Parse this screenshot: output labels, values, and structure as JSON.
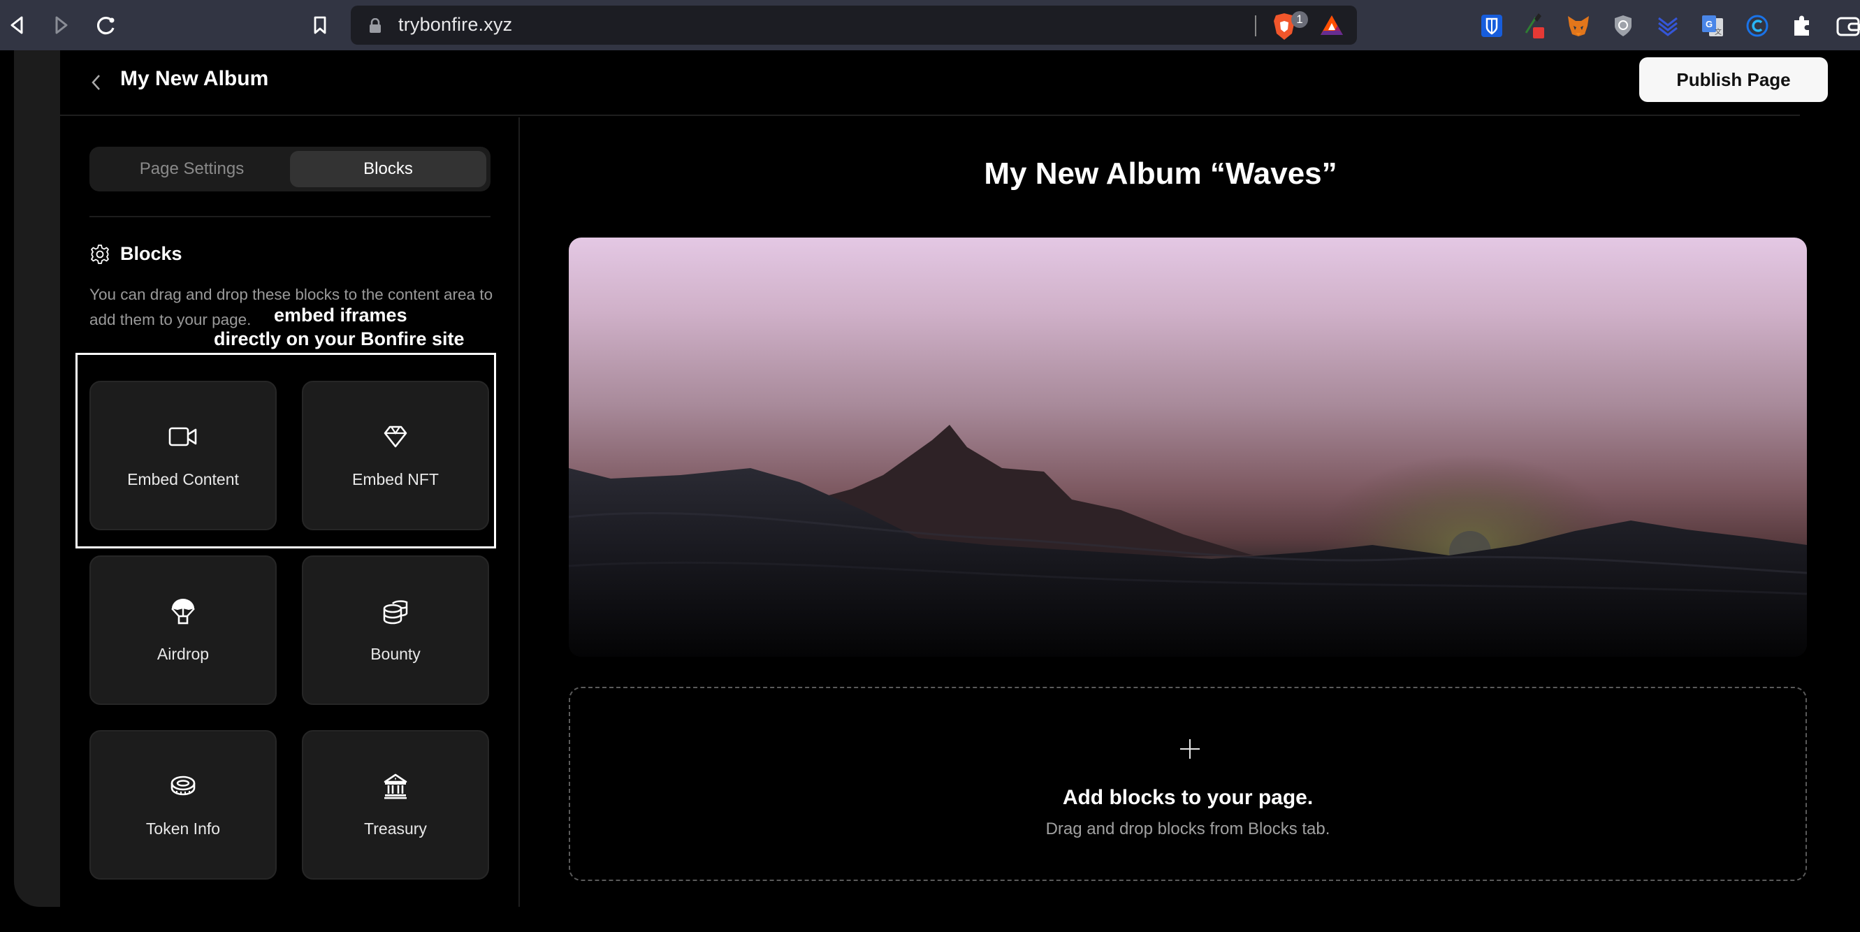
{
  "browser": {
    "url": "trybonfire.xyz",
    "brave_shield_count": "1",
    "nav": {
      "back_icon": "back-triangle-icon",
      "forward_icon": "forward-triangle-icon",
      "reload_icon": "reload-icon",
      "bookmark_icon": "bookmark-icon"
    },
    "extensions": [
      {
        "name": "bitwarden-icon",
        "color": "#175ddc"
      },
      {
        "name": "color-picker-icon",
        "color": "#e53935"
      },
      {
        "name": "metamask-icon",
        "color": "#e2761b"
      },
      {
        "name": "shield-extension-icon",
        "color": "#b0b4bc"
      },
      {
        "name": "chevron-stack-extension-icon",
        "color": "#3556d8"
      },
      {
        "name": "google-translate-icon",
        "color": "#4a86e8"
      },
      {
        "name": "c-circle-extension-icon",
        "color": "#1a73e8"
      },
      {
        "name": "puzzle-extensions-icon",
        "color": "#ffffff"
      },
      {
        "name": "wallet-icon",
        "color": "#ffffff"
      }
    ]
  },
  "header": {
    "title": "My New Album",
    "publish_label": "Publish Page"
  },
  "sidebar": {
    "tabs": [
      {
        "label": "Page Settings",
        "active": false
      },
      {
        "label": "Blocks",
        "active": true
      }
    ],
    "section_title": "Blocks",
    "section_icon": "gear-icon",
    "description": "You can drag and drop these blocks to the content area to add them to your page.",
    "annotation_line1": "embed iframes",
    "annotation_line2": "directly on your Bonfire site",
    "blocks": [
      {
        "label": "Embed Content",
        "icon": "video-camera-icon"
      },
      {
        "label": "Embed NFT",
        "icon": "diamond-icon"
      },
      {
        "label": "Airdrop",
        "icon": "parachute-icon"
      },
      {
        "label": "Bounty",
        "icon": "coins-stack-icon"
      },
      {
        "label": "Token Info",
        "icon": "token-coin-icon"
      },
      {
        "label": "Treasury",
        "icon": "bank-icon"
      }
    ]
  },
  "main": {
    "page_heading": "My New Album “Waves”",
    "hero_image": "mountain-waves-sunset-image",
    "drop_zone": {
      "title": "Add blocks to your page.",
      "subtitle": "Drag and drop blocks from Blocks tab."
    }
  },
  "colors": {
    "background": "#000000",
    "card": "#1c1c1c",
    "publish_button": "#f7f7f7",
    "browser_chrome": "#323543"
  }
}
